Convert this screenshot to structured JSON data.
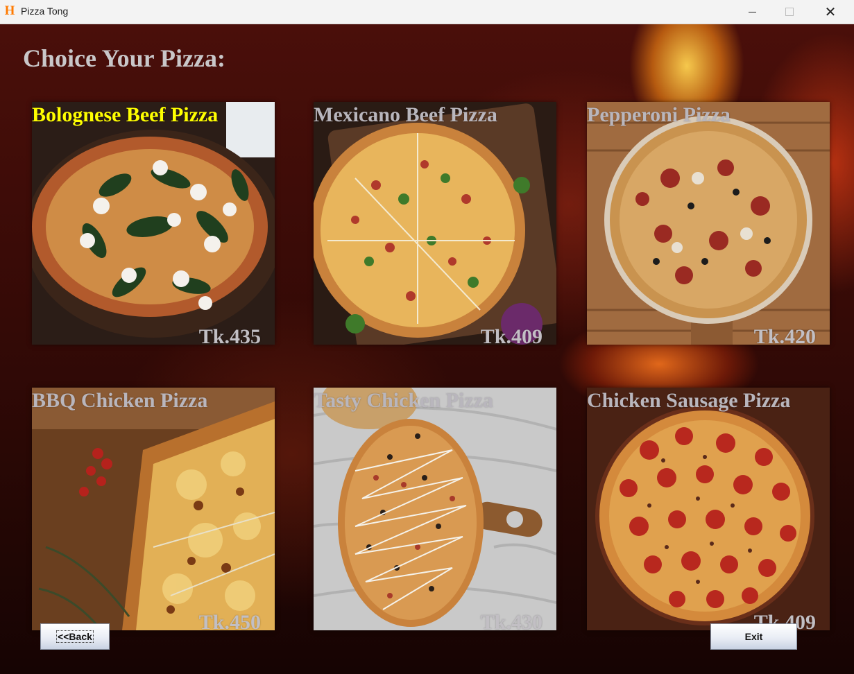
{
  "window": {
    "title": "Pizza Tong",
    "icon": "h-app-icon",
    "controls": [
      "minimize",
      "maximize",
      "close"
    ]
  },
  "heading": "Choice Your Pizza:",
  "pizzas": [
    {
      "name": "Bolognese Beef Pizza",
      "price": "Tk.435",
      "highlighted": true
    },
    {
      "name": "Mexicano Beef Pizza",
      "price": "Tk.409",
      "highlighted": false
    },
    {
      "name": "Pepperoni Pizza",
      "price": "Tk.420",
      "highlighted": false
    },
    {
      "name": "BBQ Chicken Pizza",
      "price": "Tk.450",
      "highlighted": false
    },
    {
      "name": "Tasty Chicken Pizza",
      "price": "Tk.430",
      "highlighted": false
    },
    {
      "name": "Chicken Sausage Pizza",
      "price": "Tk.409",
      "highlighted": false
    }
  ],
  "buttons": {
    "back": "<<Back",
    "exit": "Exit"
  },
  "colors": {
    "highlight": "#ffff00",
    "label": "#b9b6bd",
    "titlebar": "#f3f3f3",
    "app_icon": "#ff7a00"
  }
}
